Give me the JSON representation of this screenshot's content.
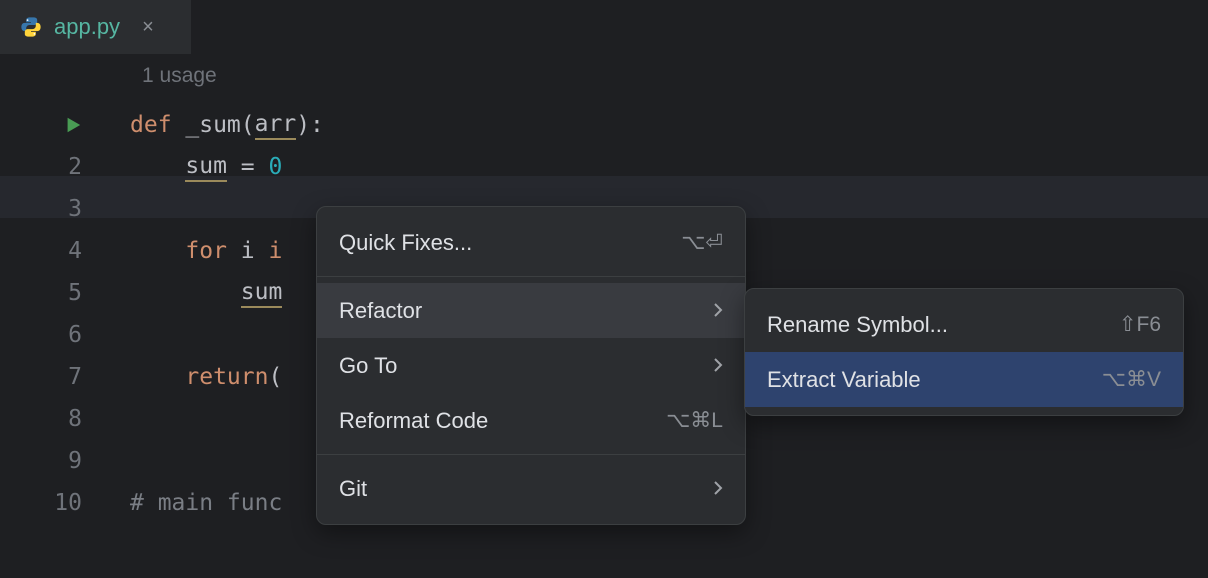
{
  "tab": {
    "filename": "app.py",
    "close_glyph": "×"
  },
  "editor": {
    "usage_hint": "1 usage",
    "gutter_lines": [
      "2",
      "3",
      "4",
      "5",
      "6",
      "7",
      "8",
      "9",
      "10"
    ],
    "lines": {
      "l1": {
        "def": "def ",
        "fn": "_sum",
        "open": "(",
        "param": "arr",
        "close": "):"
      },
      "l2": {
        "indent": "    ",
        "var": "sum",
        "rest": " = ",
        "num": "0"
      },
      "l3": {
        "text": ""
      },
      "l4": {
        "indent": "    ",
        "kw": "for ",
        "i": "i ",
        "kw2": "i"
      },
      "l5": {
        "indent": "        ",
        "var": "sum"
      },
      "l6": {
        "text": ""
      },
      "l7": {
        "indent": "    ",
        "kw": "return",
        "open": "("
      },
      "l8": {
        "text": ""
      },
      "l9": {
        "text": ""
      },
      "l10": {
        "comment": "# main func"
      }
    }
  },
  "context_menu1": [
    {
      "label": "Quick Fixes...",
      "shortcut": "⌥⏎",
      "arrow": false,
      "state": ""
    },
    {
      "sep": true
    },
    {
      "label": "Refactor",
      "shortcut": "",
      "arrow": true,
      "state": "hover"
    },
    {
      "label": "Go To",
      "shortcut": "",
      "arrow": true,
      "state": ""
    },
    {
      "label": "Reformat Code",
      "shortcut": "⌥⌘L",
      "arrow": false,
      "state": ""
    },
    {
      "sep": true
    },
    {
      "label": "Git",
      "shortcut": "",
      "arrow": true,
      "state": ""
    }
  ],
  "context_menu2": [
    {
      "label": "Rename Symbol...",
      "shortcut": "⇧F6",
      "arrow": false,
      "state": ""
    },
    {
      "label": "Extract Variable",
      "shortcut": "⌥⌘V",
      "arrow": false,
      "state": "selected"
    }
  ]
}
